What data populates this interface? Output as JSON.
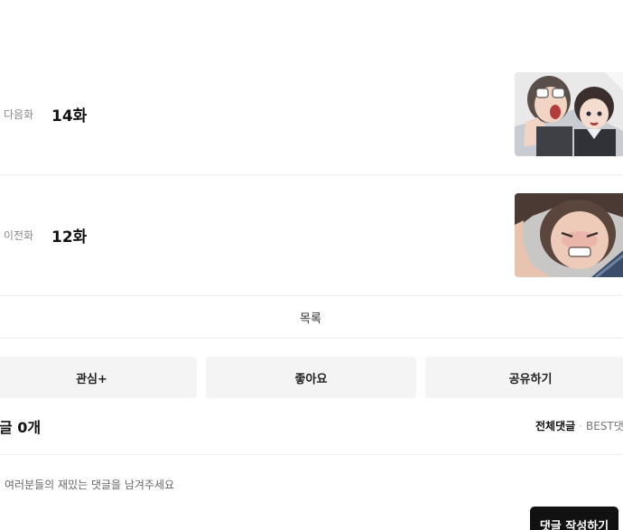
{
  "episodes": {
    "next": {
      "label": "다음화",
      "title": "14화"
    },
    "prev": {
      "label": "이전화",
      "title": "12화"
    }
  },
  "list_label": "목록",
  "actions": {
    "interest": "관심+",
    "like": "좋아요",
    "share": "공유하기"
  },
  "comments": {
    "count_label": "글 0개",
    "tab_all": "전체댓글",
    "tab_sep": "·",
    "tab_best": "BEST댓",
    "placeholder": "여러분들의 재밌는 댓글을 남겨주세요",
    "submit_label": "댓글 작성하기"
  }
}
